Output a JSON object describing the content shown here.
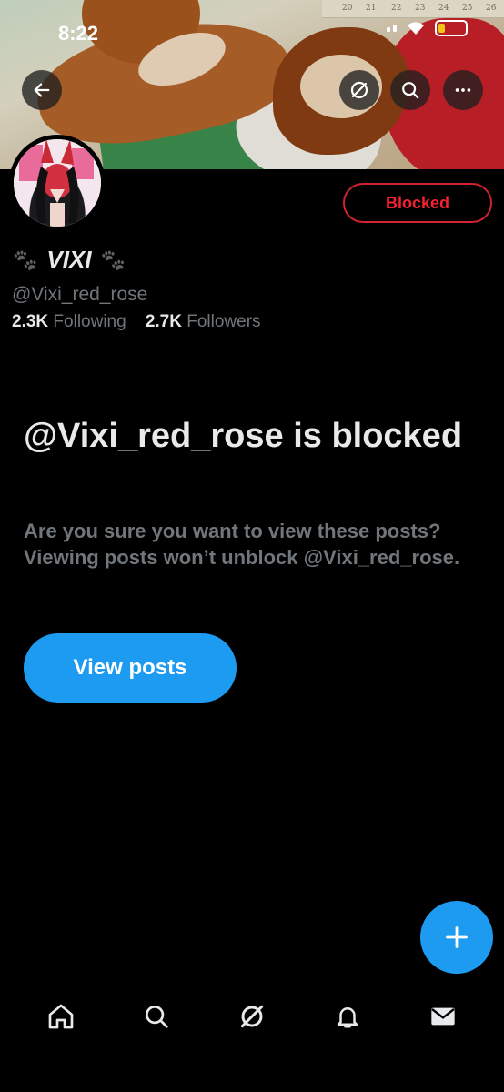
{
  "status_bar": {
    "time": "8:22"
  },
  "banner": {
    "calendar_numbers": [
      "20",
      "21",
      "22",
      "23",
      "24",
      "25",
      "26"
    ]
  },
  "header": {
    "back_icon": "arrow-left-icon",
    "grok_icon": "slash-circle-icon",
    "search_icon": "search-icon",
    "more_icon": "more-horizontal-icon"
  },
  "profile": {
    "display_name": "VIXI",
    "name_emoji": "🐾",
    "handle": "@Vixi_red_rose",
    "following_count": "2.3K",
    "following_label": "Following",
    "followers_count": "2.7K",
    "followers_label": "Followers",
    "blocked_label": "Blocked"
  },
  "blocked_notice": {
    "title": "@Vixi_red_rose is blocked",
    "body": "Are you sure you want to view these posts? Viewing posts won’t unblock @Vixi_red_rose.",
    "button": "View posts"
  },
  "fab": {
    "icon": "plus-icon"
  },
  "bottom_nav": [
    "home-icon",
    "search-icon",
    "grok-icon",
    "bell-icon",
    "mail-icon"
  ],
  "colors": {
    "accent": "#1d9bf0",
    "blocked": "#f4212e",
    "muted": "#71767b",
    "text": "#e7e9ea",
    "background": "#000000"
  }
}
